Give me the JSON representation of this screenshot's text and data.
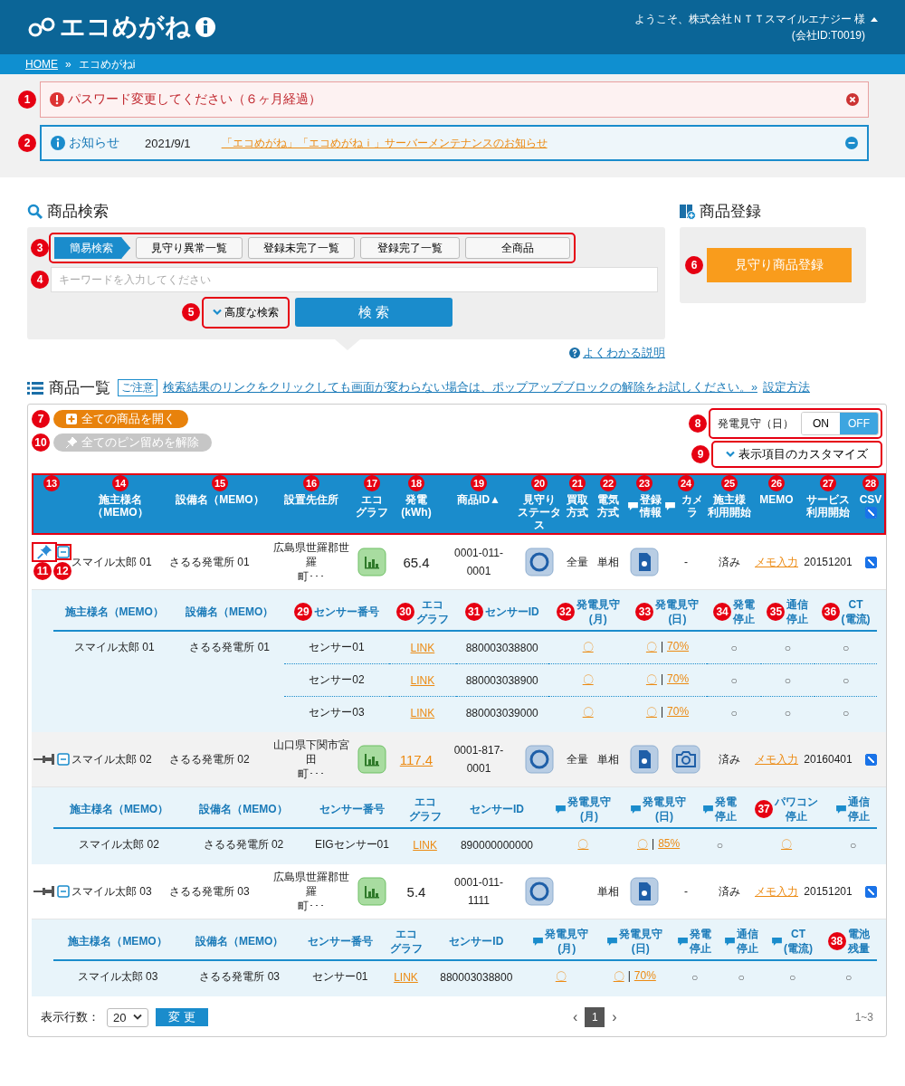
{
  "header": {
    "logo": "エコめがね",
    "welcome": "ようこそ、株式会社ＮＴＴスマイルエナジー 様",
    "company": "(会社ID:T0019)"
  },
  "breadcrumb": {
    "items": [
      "HOME",
      "エコめがねi"
    ],
    "separator": "»"
  },
  "password_alert": {
    "callout": "1",
    "text": "パスワード変更してください（６ヶ月経過）"
  },
  "notice": {
    "callout": "2",
    "label": "お知らせ",
    "date": "2021/9/1",
    "link": "「エコめがね」「エコめがねｉ」サーバーメンテナンスのお知らせ"
  },
  "search": {
    "title": "商品検索",
    "tabs_callout": "3",
    "tabs": [
      {
        "label": "簡易検索",
        "selected": true
      },
      {
        "label": "見守り異常一覧",
        "selected": false
      },
      {
        "label": "登録未完了一覧",
        "selected": false
      },
      {
        "label": "登録完了一覧",
        "selected": false
      },
      {
        "label": "全商品",
        "selected": false
      }
    ],
    "keyword": {
      "callout": "4",
      "placeholder": "キーワードを入力してください"
    },
    "advanced": {
      "callout": "5",
      "label": "高度な検索"
    },
    "button": "検 索",
    "help": "よくわかる説明"
  },
  "register": {
    "title": "商品登録",
    "callout": "6",
    "button": "見守り商品登録"
  },
  "list": {
    "title": "商品一覧",
    "notice_tag": "ご注意",
    "notice": "検索結果のリンクをクリックしても画面が変わらない場合は、ポップアップブロックの解除をお試しください。»",
    "settings_link": "設定方法",
    "open_all": {
      "callout": "7",
      "label": "全ての商品を開く"
    },
    "unpin_all": {
      "callout": "10",
      "label": "全てのピン留めを解除"
    },
    "toggle": {
      "callout": "8",
      "label": "発電見守（日）",
      "options": [
        {
          "label": "ON",
          "selected": false
        },
        {
          "label": "OFF",
          "selected": true
        }
      ]
    },
    "customize": {
      "callout": "9",
      "label": "表示項目のカスタマイズ"
    },
    "header_callout": "13",
    "columns": [
      {
        "kind": "text",
        "label": [
          "施主様名（MEMO）"
        ],
        "callout": "14"
      },
      {
        "kind": "text",
        "label": [
          "設備名（MEMO）"
        ],
        "callout": "15"
      },
      {
        "kind": "text",
        "label": [
          "設置先住所"
        ],
        "callout": "16"
      },
      {
        "kind": "text",
        "label": [
          "エコ",
          "グラフ"
        ],
        "callout": "17"
      },
      {
        "kind": "text",
        "label": [
          "発電",
          "(kWh)"
        ],
        "callout": "18"
      },
      {
        "kind": "text",
        "label": [
          "商品ID▲"
        ],
        "callout": "19"
      },
      {
        "kind": "text",
        "label": [
          "見守り",
          "ステータス"
        ],
        "callout": "20"
      },
      {
        "kind": "text",
        "label": [
          "買取",
          "方式"
        ],
        "callout": "21"
      },
      {
        "kind": "text",
        "label": [
          "電気",
          "方式"
        ],
        "callout": "22"
      },
      {
        "kind": "comment",
        "label": [
          "登録",
          "情報"
        ],
        "callout": "23"
      },
      {
        "kind": "comment",
        "label": [
          "カメラ"
        ],
        "callout": "24"
      },
      {
        "kind": "text",
        "label": [
          "施主様",
          "利用開始"
        ],
        "callout": "25"
      },
      {
        "kind": "text",
        "label": [
          "MEMO"
        ],
        "callout": "26"
      },
      {
        "kind": "text",
        "label": [
          "サービス",
          "利用開始"
        ],
        "callout": "27"
      },
      {
        "kind": "check",
        "label": [
          "CSV"
        ],
        "callout": "28",
        "checked": true
      }
    ],
    "rows": [
      {
        "pinned": true,
        "expanded": true,
        "pin_callout": "11",
        "expand_callout": "12",
        "owner": "スマイル太郎 01",
        "facility": "さるる発電所 01",
        "address": [
          "広島県世羅郡世羅",
          "町･･･"
        ],
        "generation": "65.4",
        "generation_link": false,
        "product_id": "0001-011-\n0001",
        "purchase": "全量",
        "electric": "単相",
        "camera": {
          "kind": "text",
          "text": "-"
        },
        "owner_start": "済み",
        "memo": "メモ入力",
        "service": "20151201",
        "csv": true,
        "sub_columns": [
          {
            "label": [
              "施主様名（MEMO）"
            ],
            "comment": false
          },
          {
            "label": [
              "設備名（MEMO）"
            ],
            "comment": false
          },
          {
            "label": [
              "センサー番号"
            ],
            "callout": "29",
            "comment": false
          },
          {
            "label": [
              "エコ",
              "グラフ"
            ],
            "callout": "30",
            "comment": false
          },
          {
            "label": [
              "センサーID"
            ],
            "callout": "31",
            "comment": false
          },
          {
            "label": [
              "発電見守",
              "(月)"
            ],
            "callout": "32",
            "comment": false
          },
          {
            "label": [
              "発電見守",
              "(日)"
            ],
            "callout": "33",
            "comment": false
          },
          {
            "label": [
              "発電",
              "停止"
            ],
            "callout": "34",
            "comment": false
          },
          {
            "label": [
              "通信",
              "停止"
            ],
            "callout": "35",
            "comment": false
          },
          {
            "label": [
              "CT",
              "(電流)"
            ],
            "callout": "36",
            "comment": false
          }
        ],
        "sub_rows": [
          {
            "cells": [
              {
                "kind": "text",
                "text": "スマイル太郎 01"
              },
              {
                "kind": "text",
                "text": "さるる発電所 01"
              },
              {
                "kind": "text",
                "text": "センサー01"
              },
              {
                "kind": "link",
                "text": "LINK"
              },
              {
                "kind": "text",
                "text": "880003038800"
              },
              {
                "kind": "link",
                "text": "〇"
              },
              {
                "kind": "daily",
                "mark": "〇",
                "sep": "|",
                "pct": "70%"
              },
              {
                "kind": "dot",
                "text": "○"
              },
              {
                "kind": "dot",
                "text": "○"
              },
              {
                "kind": "dot",
                "text": "○"
              }
            ]
          },
          {
            "cells": [
              {
                "kind": "blank"
              },
              {
                "kind": "blank"
              },
              {
                "kind": "text",
                "text": "センサー02"
              },
              {
                "kind": "link",
                "text": "LINK"
              },
              {
                "kind": "text",
                "text": "880003038900"
              },
              {
                "kind": "link",
                "text": "〇"
              },
              {
                "kind": "daily",
                "mark": "〇",
                "sep": "|",
                "pct": "70%"
              },
              {
                "kind": "dot",
                "text": "○"
              },
              {
                "kind": "dot",
                "text": "○"
              },
              {
                "kind": "dot",
                "text": "○"
              }
            ]
          },
          {
            "cells": [
              {
                "kind": "blank"
              },
              {
                "kind": "blank"
              },
              {
                "kind": "text",
                "text": "センサー03"
              },
              {
                "kind": "link",
                "text": "LINK"
              },
              {
                "kind": "text",
                "text": "880003039000"
              },
              {
                "kind": "link",
                "text": "〇"
              },
              {
                "kind": "daily",
                "mark": "〇",
                "sep": "|",
                "pct": "70%"
              },
              {
                "kind": "dot",
                "text": "○"
              },
              {
                "kind": "dot",
                "text": "○"
              },
              {
                "kind": "dot",
                "text": "○"
              }
            ]
          }
        ]
      },
      {
        "pinned": false,
        "expanded": true,
        "owner": "スマイル太郎 02",
        "facility": "さるる発電所 02",
        "address": [
          "山口県下関市宮田",
          "町･･･"
        ],
        "generation": "117.4",
        "generation_link": true,
        "product_id": "0001-817-\n0001",
        "purchase": "全量",
        "electric": "単相",
        "camera": {
          "kind": "icon"
        },
        "owner_start": "済み",
        "memo": "メモ入力",
        "service": "20160401",
        "csv": true,
        "sub_columns": [
          {
            "label": [
              "施主様名（MEMO）"
            ],
            "comment": false
          },
          {
            "label": [
              "設備名（MEMO）"
            ],
            "comment": false
          },
          {
            "label": [
              "センサー番号"
            ],
            "comment": false
          },
          {
            "label": [
              "エコ",
              "グラフ"
            ],
            "comment": false
          },
          {
            "label": [
              "センサーID"
            ],
            "comment": false
          },
          {
            "label": [
              "発電見守",
              "(月)"
            ],
            "comment": true
          },
          {
            "label": [
              "発電見守",
              "(日)"
            ],
            "comment": true
          },
          {
            "label": [
              "発電",
              "停止"
            ],
            "comment": true
          },
          {
            "label": [
              "パワコン",
              "停止"
            ],
            "callout": "37",
            "comment": false
          },
          {
            "label": [
              "通信",
              "停止"
            ],
            "comment": true
          }
        ],
        "sub_rows": [
          {
            "cells": [
              {
                "kind": "text",
                "text": "スマイル太郎 02"
              },
              {
                "kind": "text",
                "text": "さるる発電所 02"
              },
              {
                "kind": "text",
                "text": "EIGセンサー01"
              },
              {
                "kind": "link",
                "text": "LINK"
              },
              {
                "kind": "text",
                "text": "890000000000"
              },
              {
                "kind": "link",
                "text": "〇"
              },
              {
                "kind": "daily",
                "mark": "〇",
                "sep": "|",
                "pct": "85%"
              },
              {
                "kind": "dot",
                "text": "○"
              },
              {
                "kind": "link",
                "text": "〇"
              },
              {
                "kind": "dot",
                "text": "○"
              }
            ]
          }
        ]
      },
      {
        "pinned": false,
        "expanded": true,
        "owner": "スマイル太郎 03",
        "facility": "さるる発電所 03",
        "address": [
          "広島県世羅郡世羅",
          "町･･･"
        ],
        "generation": "5.4",
        "generation_link": false,
        "product_id": "0001-011-\n1111",
        "electric": "単相",
        "camera": {
          "kind": "text",
          "text": "-"
        },
        "owner_start": "済み",
        "memo": "メモ入力",
        "service": "20151201",
        "csv": true,
        "sub_columns": [
          {
            "label": [
              "施主様名（MEMO）"
            ],
            "comment": false
          },
          {
            "label": [
              "設備名（MEMO）"
            ],
            "comment": false
          },
          {
            "label": [
              "センサー番号"
            ],
            "comment": false
          },
          {
            "label": [
              "エコ",
              "グラフ"
            ],
            "comment": false
          },
          {
            "label": [
              "センサーID"
            ],
            "comment": false
          },
          {
            "label": [
              "発電見守",
              "(月)"
            ],
            "comment": true
          },
          {
            "label": [
              "発電見守",
              "(日)"
            ],
            "comment": true
          },
          {
            "label": [
              "発電",
              "停止"
            ],
            "comment": true
          },
          {
            "label": [
              "通信",
              "停止"
            ],
            "comment": true
          },
          {
            "label": [
              "CT",
              "(電流)"
            ],
            "comment": true
          },
          {
            "label": [
              "電池",
              "残量"
            ],
            "callout": "38",
            "comment": false
          }
        ],
        "sub_rows": [
          {
            "cells": [
              {
                "kind": "text",
                "text": "スマイル太郎 03"
              },
              {
                "kind": "text",
                "text": "さるる発電所 03"
              },
              {
                "kind": "text",
                "text": "センサー01"
              },
              {
                "kind": "link",
                "text": "LINK"
              },
              {
                "kind": "text",
                "text": "880003038800"
              },
              {
                "kind": "link",
                "text": "〇"
              },
              {
                "kind": "daily",
                "mark": "〇",
                "sep": "|",
                "pct": "70%"
              },
              {
                "kind": "dot",
                "text": "○"
              },
              {
                "kind": "dot",
                "text": "○"
              },
              {
                "kind": "dot",
                "text": "○"
              },
              {
                "kind": "dot",
                "text": "○"
              }
            ]
          }
        ]
      }
    ],
    "footer": {
      "rows_label": "表示行数：",
      "rows_value": "20",
      "change": "変 更",
      "prev": "‹",
      "pages": [
        {
          "label": "1",
          "selected": true
        }
      ],
      "next": "›",
      "range": "1~3"
    }
  }
}
